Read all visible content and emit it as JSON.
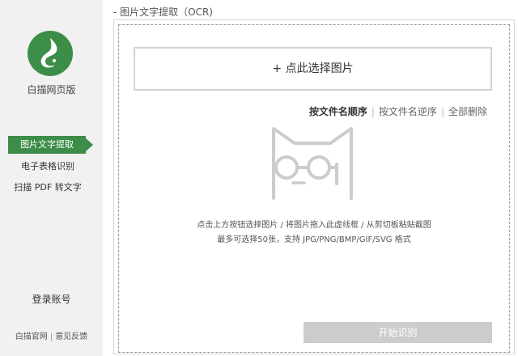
{
  "colors": {
    "brand_green": "#3c8d48",
    "sidebar_bg": "#f1f1f1",
    "button_disabled": "#cccccc",
    "illustration": "#cccccc"
  },
  "sidebar": {
    "brand": "白描网页版",
    "nav": [
      {
        "label": "图片文字提取",
        "active": true
      },
      {
        "label": "电子表格识别",
        "active": false
      },
      {
        "label": "扫描 PDF 转文字",
        "active": false
      }
    ],
    "login": "登录账号",
    "links": [
      {
        "label": "白描官网"
      },
      {
        "separator": "|"
      },
      {
        "label": "意见反馈"
      }
    ]
  },
  "main": {
    "section_title": "- 图片文字提取（OCR)",
    "select_button": "+ 点此选择图片",
    "sort": {
      "options": [
        {
          "label": "按文件名顺序",
          "active": true
        },
        {
          "label": "按文件名逆序",
          "active": false
        },
        {
          "label": "全部删除",
          "active": false
        }
      ],
      "separator": "|"
    },
    "illustration_icon": "cat-with-glasses-icon",
    "hint_line1": "点击上方按钮选择图片 / 将图片拖入此虚线框 / 从剪切板粘贴截图",
    "hint_line2": "最多可选择50张，支持 JPG/PNG/BMP/GIF/SVG 格式",
    "start_button": "开始识别"
  }
}
